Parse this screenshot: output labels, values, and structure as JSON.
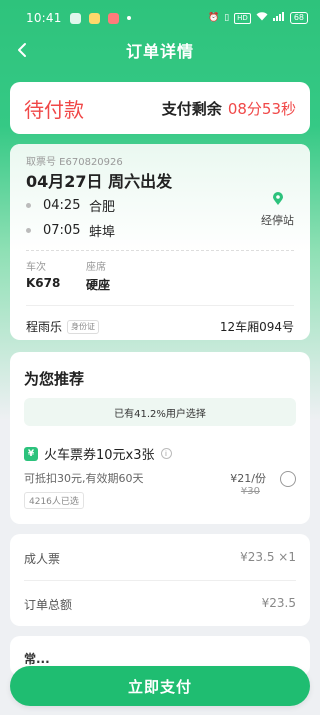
{
  "status_bar": {
    "time": "10:41",
    "signal_text": "HD",
    "battery": "68"
  },
  "nav": {
    "title": "订单详情"
  },
  "order": {
    "status": "待付款",
    "countdown_label": "支付剩余",
    "countdown_time": "08分53秒"
  },
  "ticket": {
    "pickup_no": "取票号 E670820926",
    "depart": "04月27日 周六出发",
    "stops": [
      {
        "time": "04:25",
        "name": "合肥"
      },
      {
        "time": "07:05",
        "name": "蚌埠"
      }
    ],
    "via_label": "经停站",
    "train_label": "车次",
    "train_value": "K678",
    "seat_label": "座席",
    "seat_value": "硬座",
    "passenger_name": "程雨乐",
    "passenger_id_tag": "身份证",
    "seat_no": "12车厢094号"
  },
  "recommend": {
    "title": "为您推荐",
    "banner": "已有41.2%用户选择",
    "coupon_icon": "¥",
    "coupon_name": "火车票券10元x3张",
    "coupon_desc": "可抵扣30元,有效期60天",
    "coupon_count": "4216人已选",
    "price_now": "¥21/份",
    "price_old": "¥30"
  },
  "price": {
    "rows": [
      {
        "label": "成人票",
        "value": "¥23.5 ×1"
      },
      {
        "label": "订单总额",
        "value": "¥23.5"
      }
    ]
  },
  "peek": {
    "text": "常..."
  },
  "pay_button": "立即支付",
  "colors": {
    "brand_green": "#1fbd71",
    "alert_red": "#f04848"
  }
}
